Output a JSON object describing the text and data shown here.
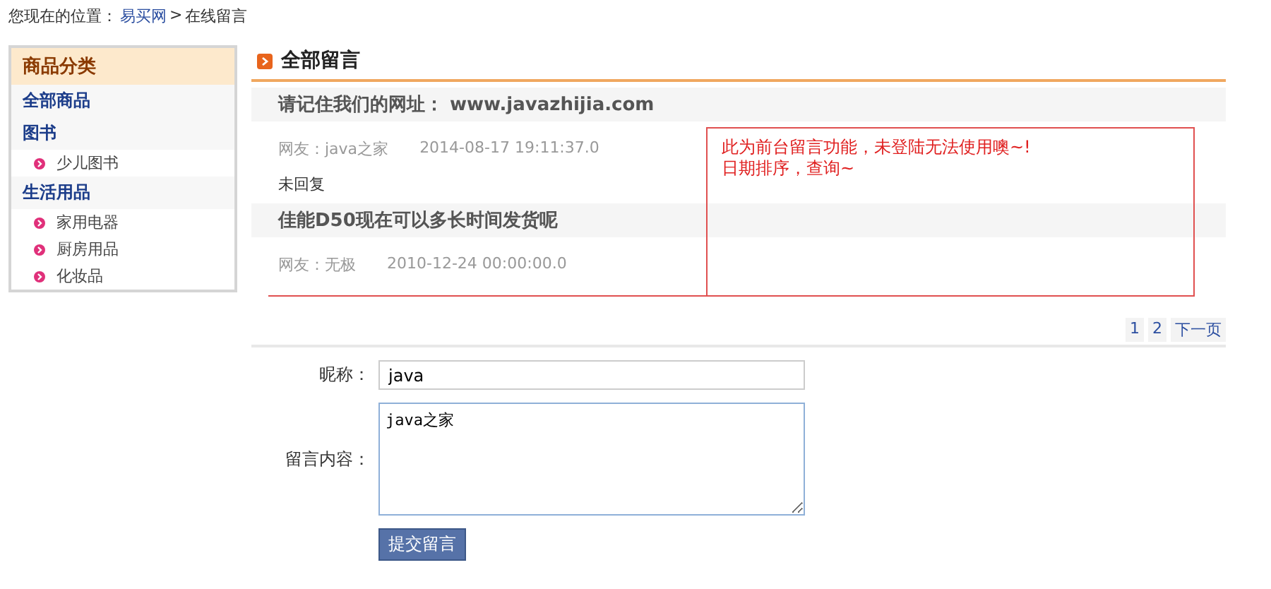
{
  "breadcrumb": {
    "prefix": "您现在的位置：",
    "home": "易买网",
    "separator": ">",
    "current": "在线留言"
  },
  "sidebar": {
    "title": "商品分类",
    "groups": [
      {
        "label": "全部商品"
      },
      {
        "label": "图书",
        "children": [
          {
            "label": "少儿图书"
          }
        ]
      },
      {
        "label": "生活用品",
        "children": [
          {
            "label": "家用电器"
          },
          {
            "label": "厨房用品"
          },
          {
            "label": "化妆品"
          }
        ]
      }
    ]
  },
  "section_title": "全部留言",
  "messages": [
    {
      "title": "请记住我们的网址： www.javazhijia.com",
      "author": "网友：java之家",
      "date": "2014-08-17 19:11:37.0",
      "reply": "未回复"
    },
    {
      "title": "佳能D50现在可以多长时间发货呢",
      "author": "网友：无极",
      "date": "2010-12-24 00:00:00.0"
    }
  ],
  "annotation": {
    "lines": [
      "此为前台留言功能，未登陆无法使用噢~!",
      "日期排序，查询~"
    ]
  },
  "pagination": {
    "pages": [
      "1",
      "2"
    ],
    "next": "下一页"
  },
  "form": {
    "nickname_label": "昵称：",
    "nickname_value": "java",
    "content_label": "留言内容：",
    "content_value": "java之家",
    "submit": "提交留言"
  }
}
